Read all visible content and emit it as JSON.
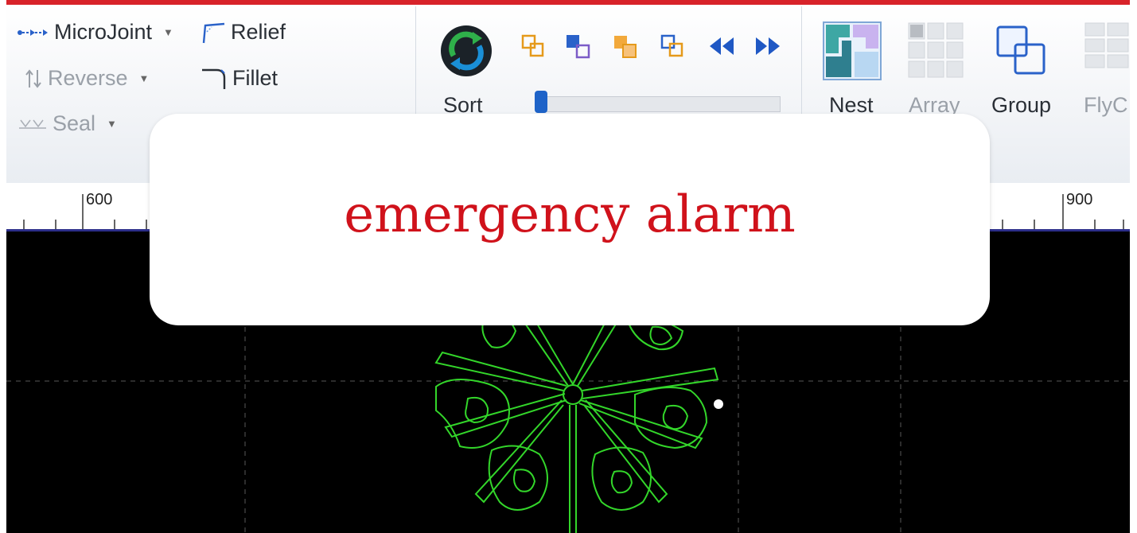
{
  "ribbon": {
    "left_group": {
      "microjoint": "MicroJoint",
      "relief": "Relief",
      "reverse": "Reverse",
      "fillet": "Fillet",
      "seal": "Seal"
    },
    "sort_group": {
      "sort": "Sort"
    },
    "nest_group": {
      "nest": "Nest",
      "array": "Array",
      "group": "Group",
      "fly": "FlyC"
    }
  },
  "ruler": {
    "label_600": "600",
    "label_900": "900"
  },
  "overlay": {
    "text": "emergency alarm"
  },
  "colors": {
    "top_bar": "#d8232a",
    "canvas": "#000000",
    "cad_lines": "#33d62a",
    "overlay_text": "#d0121b",
    "ruler_border": "#2c2e8a"
  }
}
